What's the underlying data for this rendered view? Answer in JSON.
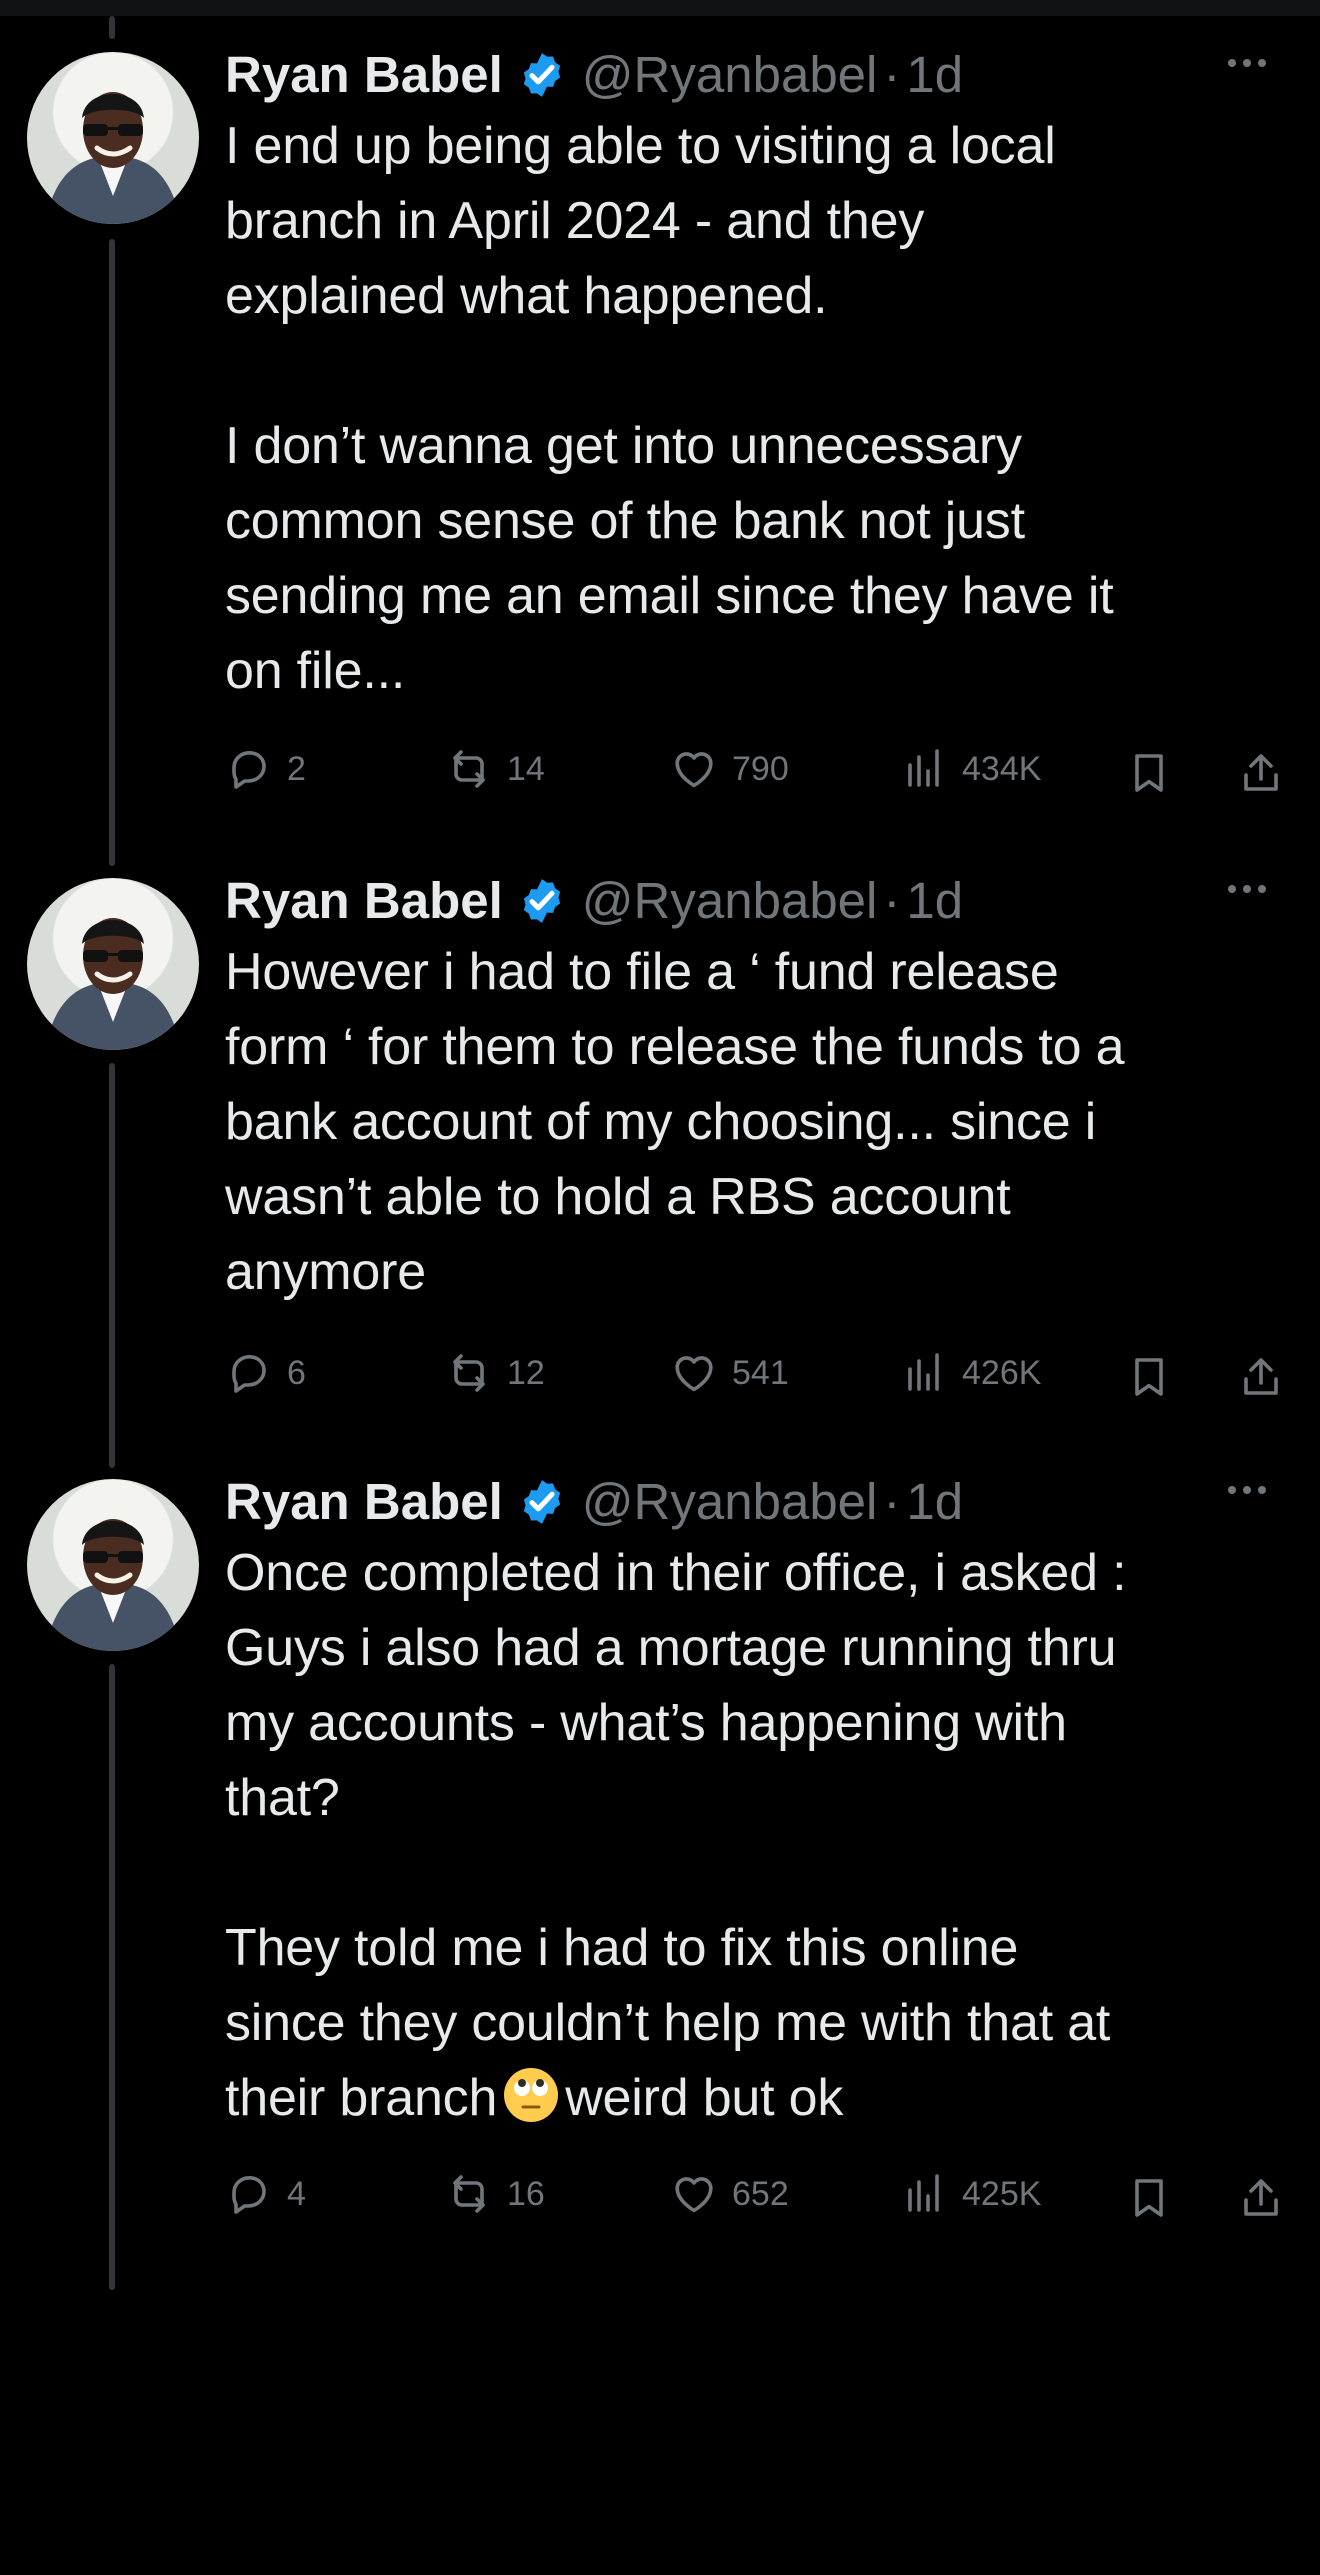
{
  "tweets": [
    {
      "name": "Ryan Babel",
      "handle": "@Ryanbabel",
      "separator": "·",
      "time": "1d",
      "text": "I end up being able to visiting a local\nbranch in April 2024 - and they\nexplained what happened.\n\nI don’t wanna get into unnecessary\ncommon sense of the bank not just\nsending me an email since they have it\non file...",
      "replies": "2",
      "reposts": "14",
      "likes": "790",
      "views": "434K"
    },
    {
      "name": "Ryan Babel",
      "handle": "@Ryanbabel",
      "separator": "·",
      "time": "1d",
      "text": "However i had to file a ‘ fund release\nform ‘ for them to release the funds to a\nbank account of my choosing...  since i\nwasn’t able to hold a RBS account\nanymore",
      "replies": "6",
      "reposts": "12",
      "likes": "541",
      "views": "426K"
    },
    {
      "name": "Ryan Babel",
      "handle": "@Ryanbabel",
      "separator": "·",
      "time": "1d",
      "text": "Once completed in their office, i asked :\nGuys i also had a mortage running thru\nmy accounts - what’s happening with\nthat?\n\nThey told me i had to fix this online\nsince they couldn’t help me with that at\ntheir branch",
      "text_after_emoji": "weird but ok",
      "emoji": "face-with-rolling-eyes",
      "replies": "4",
      "reposts": "16",
      "likes": "652",
      "views": "425K"
    }
  ],
  "colors": {
    "background": "#000000",
    "text": "#e7e9ea",
    "muted": "#71767b",
    "verified": "#1d9bf0",
    "thread_line": "#333639"
  },
  "icons": {
    "verified": "verified-badge-icon",
    "more": "more-options-icon",
    "reply": "reply-icon",
    "repost": "repost-icon",
    "like": "like-icon",
    "views": "views-icon",
    "bookmark": "bookmark-icon",
    "share": "share-icon"
  }
}
